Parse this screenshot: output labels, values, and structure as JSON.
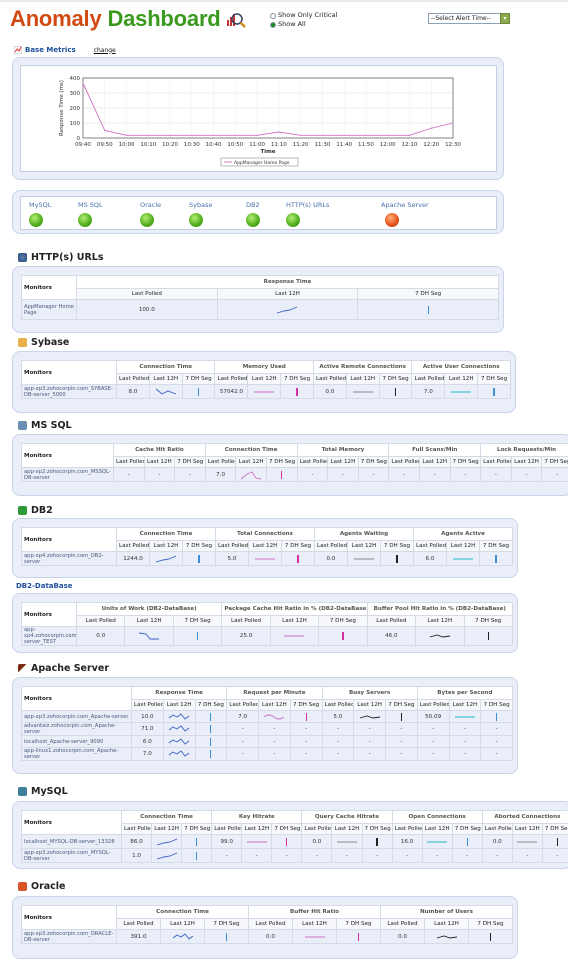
{
  "header": {
    "title_part1": "Anomaly",
    "title_part2": "Dashboard",
    "radio_critical": "Show Only Critical",
    "radio_all": "Show All",
    "alert_select": "--Select Alert Time--"
  },
  "base": {
    "label": "Base Metrics",
    "change": "change"
  },
  "chart_data": {
    "type": "line",
    "ylabel": "Response Time (ms)",
    "xlabel": "Time",
    "yticks": [
      0,
      100,
      200,
      300,
      400
    ],
    "ylim": [
      0,
      400
    ],
    "categories": [
      "09:40",
      "09:50",
      "10:00",
      "10:10",
      "10:20",
      "10:30",
      "10:40",
      "10:50",
      "11:00",
      "11:10",
      "11:20",
      "11:30",
      "11:40",
      "11:50",
      "12:00",
      "12:10",
      "12:20",
      "12:30"
    ],
    "series": [
      {
        "name": "AppManager Home Page",
        "values": [
          365,
          50,
          18,
          18,
          18,
          18,
          18,
          18,
          18,
          40,
          18,
          18,
          18,
          18,
          18,
          18,
          65,
          100
        ]
      }
    ],
    "legend": "bottom",
    "grid": true
  },
  "monitors": [
    {
      "name": "MySQL",
      "status": "green"
    },
    {
      "name": "MS SQL",
      "status": "green"
    },
    {
      "name": "Oracle",
      "status": "green"
    },
    {
      "name": "Sybase",
      "status": "green"
    },
    {
      "name": "DB2",
      "status": "green"
    },
    {
      "name": "HTTP(s) URLs",
      "status": "green"
    },
    {
      "name": "Apache Server",
      "status": "red"
    }
  ],
  "common": {
    "monitors": "Monitors",
    "last_polled": "Last Polled",
    "last12": "Last 12H",
    "seven": "7 DH Seg",
    "dash": "-",
    "dot": "."
  },
  "http": {
    "title": "HTTP(s) URLs",
    "group": "Response Time",
    "row": {
      "name": "AppManager Home Page",
      "value": "100.0"
    }
  },
  "sybase": {
    "title": "Sybase",
    "groups": [
      "Connection Time",
      "Memory Used",
      "Active Remote Connections",
      "Active User Connections"
    ],
    "row": {
      "name": "app-xp3.zohocorpin.com_SYBASE-DB-server_5000",
      "v": [
        "8.0",
        "57042.0",
        "0.0",
        "7.0"
      ]
    }
  },
  "mssql": {
    "title": "MS SQL",
    "groups": [
      "Cache Hit Ratio",
      "Connection Time",
      "Total Memory",
      "Full Scans/Min",
      "Lock Requests/Min"
    ],
    "row": {
      "name": "app-xp2.zohocorpin.com_MSSQL-DB-server",
      "v": [
        "-",
        "7.0",
        "-",
        "-",
        "-"
      ]
    }
  },
  "db2": {
    "title": "DB2",
    "groups": [
      "Connection Time",
      "Total Connections",
      "Agents Waiting",
      "Agents Active"
    ],
    "row": {
      "name": "app-xp4.zohocorpin.com_DB2-server",
      "v": [
        "1244.0",
        "5.0",
        "0.0",
        "6.0"
      ]
    }
  },
  "db2db": {
    "title": "DB2-DataBase",
    "groups": [
      "Units of Work (DB2-DataBase)",
      "Package Cache Hit Ratio in % (DB2-DataBase)",
      "Buffer Pool Hit Ratio in % (DB2-DataBase)"
    ],
    "row": {
      "name": "app-xp4.zohocorpin.com_DB2-server_TEST",
      "v": [
        "0.0",
        "25.0",
        "46.0"
      ]
    }
  },
  "apache": {
    "title": "Apache Server",
    "groups": [
      "Response Time",
      "Request per Minute",
      "Busy Servers",
      "Bytes per Second"
    ],
    "rows": [
      {
        "name": "app-xp3.zohocorpin.com_Apache-server",
        "v": [
          "10.0",
          "7.0",
          "5.0",
          "50.09"
        ]
      },
      {
        "name": "advantaiz.zohocorpin.com_Apache-server",
        "v": [
          "71.0",
          "-",
          "-",
          "-"
        ]
      },
      {
        "name": "localhost_Apache-server_9090",
        "v": [
          "6.0",
          "-",
          "-",
          "-"
        ]
      },
      {
        "name": "app-linux1.zohocorpin.com_Apache-server",
        "v": [
          "7.0",
          "-",
          "-",
          "-"
        ]
      }
    ]
  },
  "mysql": {
    "title": "MySQL",
    "groups": [
      "Connection Time",
      "Key Hitrate",
      "Query Cache Hitrate",
      "Open Connections",
      "Aborted Connections"
    ],
    "rows": [
      {
        "name": "localhost_MYSQL-DB-server_13328",
        "v": [
          "86.0",
          "99.0",
          "0.0",
          "16.0",
          "0.0"
        ]
      },
      {
        "name": "app-xp3.zohocorpin.com_MYSQL-DB-server",
        "v": [
          "1.0",
          "-",
          "-",
          "-",
          "-"
        ]
      }
    ]
  },
  "oracle": {
    "title": "Oracle",
    "groups": [
      "Connection Time",
      "Buffer Hit Ratio",
      "Number of Users"
    ],
    "row": {
      "name": "app-xp3.zohocorpin.com_ORACLE-DB-server",
      "v": [
        "391.0",
        "0.0",
        "0.0"
      ]
    }
  }
}
